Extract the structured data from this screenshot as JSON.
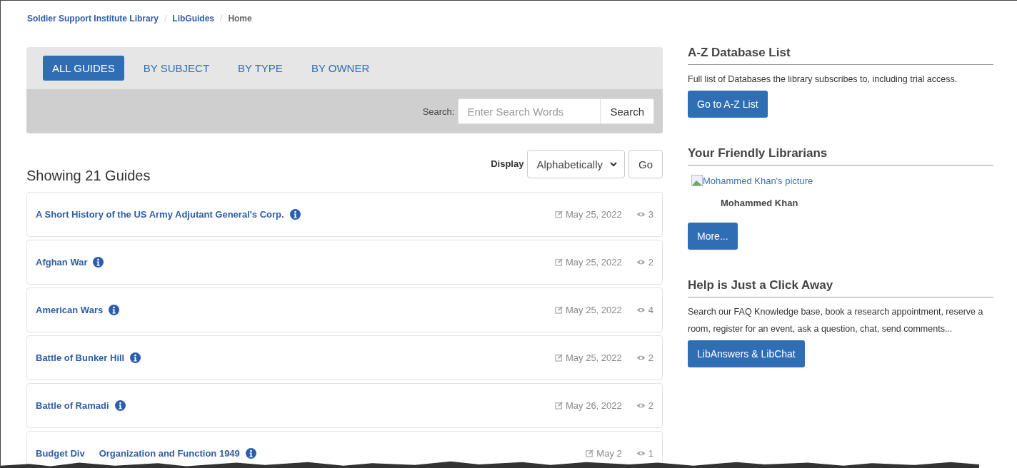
{
  "breadcrumb": [
    {
      "label": "Soldier Support Institute Library",
      "current": false
    },
    {
      "separator": "/",
      "label": "LibGuides",
      "current": false
    },
    {
      "separator": "/",
      "label": "Home",
      "current": true
    }
  ],
  "tabs": [
    {
      "label": "ALL GUIDES",
      "selected": true
    },
    {
      "label": "BY SUBJECT",
      "selected": false
    },
    {
      "label": "BY TYPE",
      "selected": false
    },
    {
      "label": "BY OWNER",
      "selected": false
    }
  ],
  "search": {
    "label": "Search:",
    "placeholder": "Enter Search Words",
    "button": "Search"
  },
  "count_heading": "Showing 21 Guides",
  "display": {
    "label": "Display",
    "value": "Alphabetically",
    "button": "Go"
  },
  "guides": [
    {
      "title": [
        "A Short History of the US Army Adjutant General's Corp."
      ],
      "date": "May 25, 2022",
      "views": "3"
    },
    {
      "title": [
        "Afghan War"
      ],
      "date": "May 25, 2022",
      "views": "2"
    },
    {
      "title": [
        "American Wars"
      ],
      "date": "May 25, 2022",
      "views": "4"
    },
    {
      "title": [
        "Battle of Bunker Hill"
      ],
      "date": "May 25, 2022",
      "views": "2"
    },
    {
      "title": [
        "Battle of Ramadi"
      ],
      "date": "May 26, 2022",
      "views": "2"
    },
    {
      "title": [
        "Budget Div",
        "Organization and Function 1949"
      ],
      "date": "May 2",
      "views": "1"
    }
  ],
  "sidebar": [
    {
      "kind": "text",
      "heading": "A-Z Database List",
      "text": "Full list of Databases the library subscribes to, including trial access.",
      "button": "Go to A-Z List"
    },
    {
      "kind": "librarian",
      "heading": "Your Friendly Librarians",
      "image_alt": "Mohammed Khan's picture",
      "name": "Mohammed Khan",
      "button": "More..."
    },
    {
      "kind": "text",
      "heading": "Help is Just a Click Away",
      "text": "Search our FAQ Knowledge base, book a research appointment, reserve a room, register for an event, ask a question, chat, send comments...",
      "button": "LibAnswers & LibChat"
    }
  ]
}
